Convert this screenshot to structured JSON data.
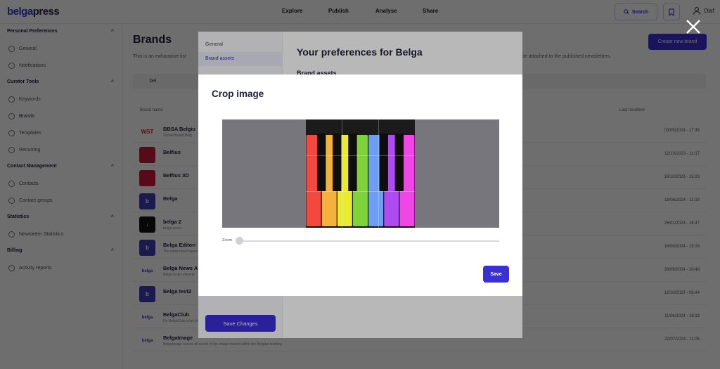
{
  "app": {
    "logo_part1": "belga",
    "logo_part2": "press"
  },
  "topnav": {
    "items": [
      "Explore",
      "Publish",
      "Analyse",
      "Share"
    ],
    "search_label": "Search",
    "user_label": "Olaf"
  },
  "sidebar": {
    "sections": [
      {
        "title": "Personal Preferences",
        "items": [
          "General",
          "Notifications"
        ]
      },
      {
        "title": "Curator Tools",
        "items": [
          "Keywords",
          "Brands",
          "Templates",
          "Recurring"
        ]
      },
      {
        "title": "Contact Management",
        "items": [
          "Contacts",
          "Contact groups"
        ]
      },
      {
        "title": "Statistics",
        "items": [
          "Newsletter Statistics"
        ]
      },
      {
        "title": "Billing",
        "items": [
          "Activity reports"
        ]
      }
    ]
  },
  "main": {
    "title": "Brands",
    "description_start": "This is an exhaustive list",
    "description_end": "be attached to the published newsletters.",
    "create_button": "Create new brand",
    "filter_value": "bel",
    "col_brand_name": "Brand name",
    "col_last_modified": "Last modified",
    "rows": [
      {
        "name": "BBSA Belgiu",
        "sub": "Showerfound Belg",
        "date": "03/05/2023 - 17:36",
        "thumb": "WST",
        "color": "#ffffff",
        "text_color": "#d11a2a"
      },
      {
        "name": "Belfius",
        "sub": "",
        "date": "12/10/2023 - 11:17",
        "thumb": "",
        "color": "#c8193c",
        "text_color": "#ffffff"
      },
      {
        "name": "Belfius 3D",
        "sub": "",
        "date": "16/10/2023 - 15:29",
        "thumb": "",
        "color": "#c8193c",
        "text_color": "#ffffff"
      },
      {
        "name": "Belga",
        "sub": "",
        "date": "18/06/2024 - 11:18",
        "thumb": "b",
        "color": "#3f3fb7",
        "text_color": "#ffffff"
      },
      {
        "name": "belga 2",
        "sub": "belga press",
        "date": "25/01/2023 - 16:47",
        "thumb": "↓",
        "color": "#111111",
        "text_color": "#ffffff"
      },
      {
        "name": "Belga Editori",
        "sub": "The news brand agen",
        "date": "16/09/2024 - 15:26",
        "thumb": "b",
        "color": "#3f3fb7",
        "text_color": "#ffffff"
      },
      {
        "name": "Belga News A",
        "sub": "Belga is de referenti",
        "date": "26/09/2024 - 10:49",
        "thumb": "belga",
        "color": "#ffffff",
        "text_color": "#3f3fb7"
      },
      {
        "name": "Belga test2",
        "sub": "",
        "date": "12/10/2023 - 08:44",
        "thumb": "b",
        "color": "#3f3fb7",
        "text_color": "#ffffff"
      },
      {
        "name": "BelgaClub",
        "sub": "De BelgaClub is het initiatief van Belga",
        "date": "11/06/2024 - 16:33",
        "thumb": "belga",
        "color": "#ffffff",
        "text_color": "#3f3fb7"
      },
      {
        "name": "BelgaImage",
        "sub": "BelgaImage serves all needs of the image market within the Belgian territory.",
        "date": "22/07/2024 - 11:05",
        "thumb": "belga",
        "color": "#ffffff",
        "text_color": "#3f3fb7"
      }
    ]
  },
  "prefs_modal": {
    "tabs": [
      "General",
      "Brand assets"
    ],
    "title": "Your preferences for Belga",
    "subtitle": "Brand assets",
    "save_changes": "Save Changes"
  },
  "crop_modal": {
    "title": "Crop image",
    "zoom_label": "Zoom",
    "zoom_value_fraction": 0.0,
    "save_label": "Save",
    "key_colors": [
      "#f2483e",
      "#f3b13d",
      "#eaea2f",
      "#7ed33a",
      "#6e9ef4",
      "#b04bf3",
      "#f046e6"
    ]
  },
  "colors": {
    "accent": "#3b2fd6"
  }
}
